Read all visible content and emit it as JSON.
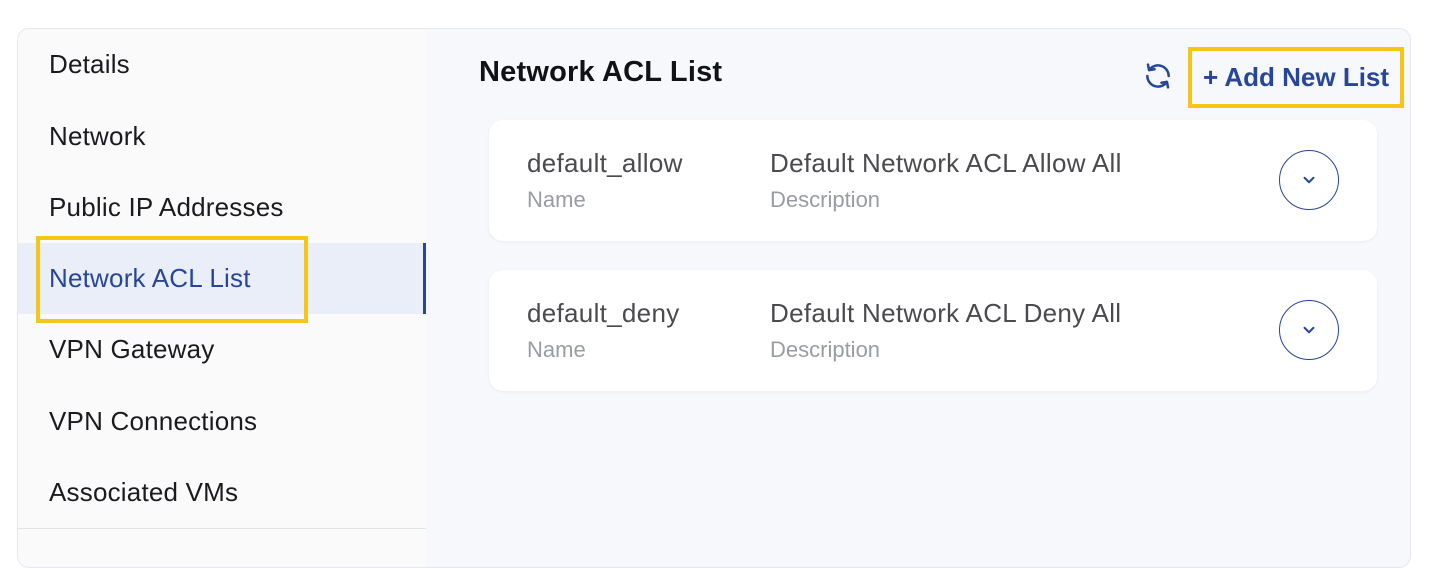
{
  "sidebar": {
    "items": [
      {
        "label": "Details"
      },
      {
        "label": "Network"
      },
      {
        "label": "Public IP Addresses"
      },
      {
        "label": "Network ACL List"
      },
      {
        "label": "VPN Gateway"
      },
      {
        "label": "VPN Connections"
      },
      {
        "label": "Associated VMs"
      }
    ],
    "active_index": 3
  },
  "main": {
    "title": "Network ACL List",
    "refresh_icon": "refresh-icon",
    "add_button_label": "+ Add New List",
    "acl_lists": [
      {
        "name": "default_allow",
        "name_label": "Name",
        "description": "Default Network ACL Allow All",
        "description_label": "Description"
      },
      {
        "name": "default_deny",
        "name_label": "Name",
        "description": "Default Network ACL Deny All",
        "description_label": "Description"
      }
    ],
    "expand_icon": "chevron-down-icon"
  },
  "colors": {
    "accent": "#27469a",
    "highlight": "#f5c518",
    "active_bg": "#e9eef8"
  }
}
